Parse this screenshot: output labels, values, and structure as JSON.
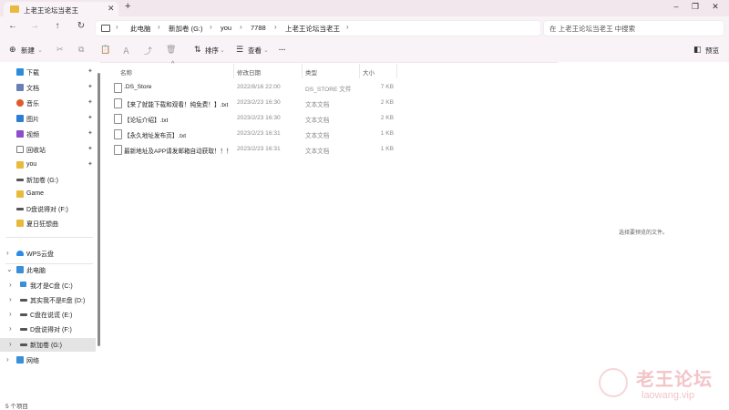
{
  "window": {
    "tab_title": "上老王论坛当老王",
    "tab_close": "✕",
    "new_tab": "+",
    "controls": {
      "minimize": "–",
      "maximize": "❐",
      "close": "✕"
    }
  },
  "nav": {
    "back": "←",
    "forward": "→",
    "up": "↑",
    "refresh": "↻"
  },
  "breadcrumb": {
    "items": [
      "此电脑",
      "新加卷 (G:)",
      "you",
      "7788",
      "上老王论坛当老王"
    ],
    "separator": "›",
    "more": "›"
  },
  "search": {
    "placeholder": "在 上老王论坛当老王 中搜索"
  },
  "commandbar": {
    "new_label": "新建",
    "new_icon": "⊕",
    "sort_label": "排序",
    "view_label": "查看",
    "more_label": "···",
    "preview_label": "预览",
    "icons": {
      "cut": "✂",
      "copy": "⧉",
      "paste": "📋",
      "rename": "Ａ",
      "share": "⤴",
      "delete": "🗑"
    }
  },
  "sidebar": {
    "quick_access": [
      {
        "label": "下载",
        "icon": "download-icon",
        "color": "#2e8bdc",
        "pinned": true
      },
      {
        "label": "文档",
        "icon": "document-icon",
        "color": "#6a7fb5",
        "pinned": true
      },
      {
        "label": "音乐",
        "icon": "music-icon",
        "color": "#e05a2a",
        "pinned": true
      },
      {
        "label": "图片",
        "icon": "picture-icon",
        "color": "#2d7dd2",
        "pinned": true
      },
      {
        "label": "视频",
        "icon": "video-icon",
        "color": "#8c4fc9",
        "pinned": true
      },
      {
        "label": "回收站",
        "icon": "recycle-bin-icon",
        "color": "#7a7a7a",
        "pinned": true
      },
      {
        "label": "you",
        "icon": "folder-icon",
        "color": "#e9b93c",
        "pinned": true
      },
      {
        "label": "新加卷 (G:)",
        "icon": "drive-icon",
        "color": "#555555",
        "pinned": false
      },
      {
        "label": "Game",
        "icon": "folder-icon",
        "color": "#e9b93c",
        "pinned": false
      },
      {
        "label": "D盘说得对 (F:)",
        "icon": "drive-icon",
        "color": "#555555",
        "pinned": false
      },
      {
        "label": "夏日狂想曲",
        "icon": "folder-icon",
        "color": "#e9b93c",
        "pinned": false
      }
    ],
    "cloud": {
      "label": "WPS云盘",
      "icon": "cloud-icon",
      "color": "#2d8ce6"
    },
    "this_pc": {
      "label": "此电脑",
      "icon": "computer-icon",
      "color": "#3a8fd8"
    },
    "drives": [
      {
        "label": "我才是C盘 (C:)",
        "icon": "windows-drive-icon"
      },
      {
        "label": "其实我不是E盘 (D:)",
        "icon": "drive-icon"
      },
      {
        "label": "C盘在说谎 (E:)",
        "icon": "drive-icon"
      },
      {
        "label": "D盘说得对 (F:)",
        "icon": "drive-icon"
      },
      {
        "label": "新加卷 (G:)",
        "icon": "drive-icon",
        "selected": true
      }
    ],
    "network": {
      "label": "网络",
      "icon": "network-icon",
      "color": "#3a8fd8"
    }
  },
  "columns": {
    "name": "名称",
    "date": "修改日期",
    "type": "类型",
    "size": "大小"
  },
  "files": [
    {
      "name": ".DS_Store",
      "date": "2022/8/16 22:00",
      "type": "DS_STORE 文件",
      "size": "7 KB"
    },
    {
      "name": "【来了就能下载和观看！纯免费！】.txt",
      "date": "2023/2/23 16:30",
      "type": "文本文档",
      "size": "2 KB"
    },
    {
      "name": "【论坛介绍】.txt",
      "date": "2023/2/23 16:30",
      "type": "文本文档",
      "size": "2 KB"
    },
    {
      "name": "【永久地址发布页】.txt",
      "date": "2023/2/23 16:31",
      "type": "文本文档",
      "size": "1 KB"
    },
    {
      "name": "最新地址及APP请发邮箱自动获取！！！...",
      "date": "2023/2/23 16:31",
      "type": "文本文档",
      "size": "1 KB"
    }
  ],
  "preview": {
    "empty_text": "选择要预览的文件。"
  },
  "status": {
    "count_text": "5 个项目"
  },
  "watermark": {
    "cn": "老王论坛",
    "en": "laowang.vip"
  }
}
